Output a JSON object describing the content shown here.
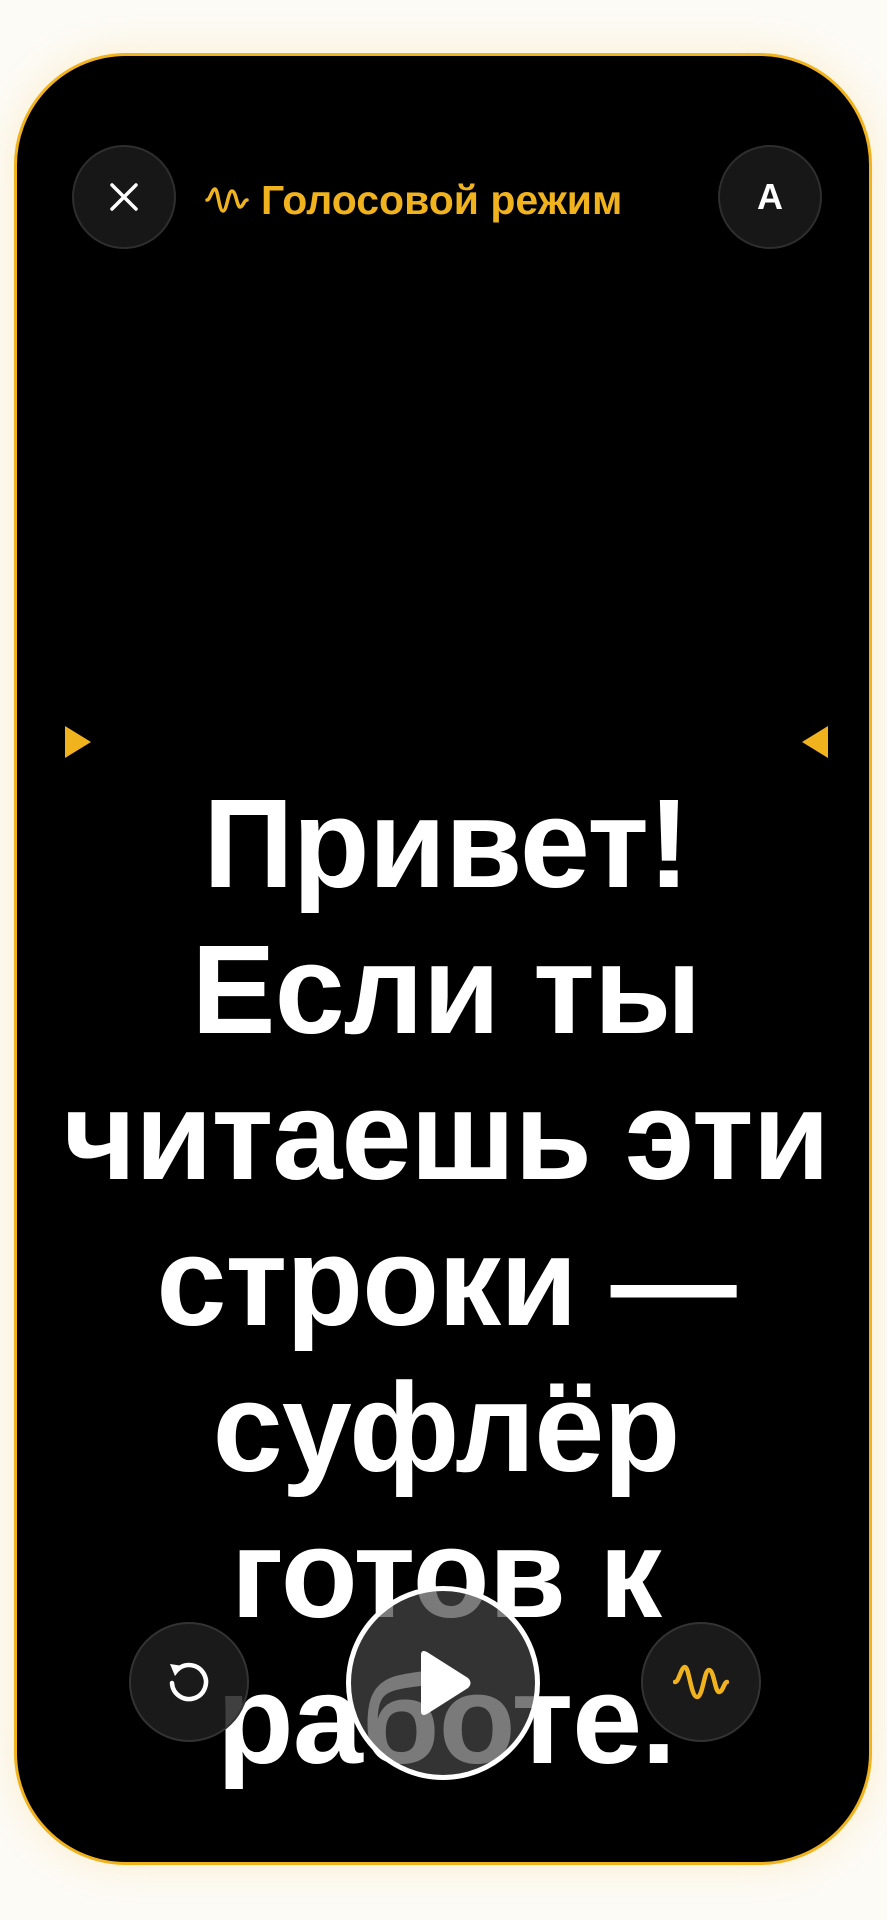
{
  "header": {
    "mode_label": "Голосовой режим",
    "font_button_label": "A"
  },
  "icons": {
    "close": "close-icon",
    "voice_wave": "wave-icon",
    "reset": "reset-icon",
    "play": "play-icon"
  },
  "script": {
    "lines": [
      "Привет!",
      "Если ты",
      "читаешь эти",
      "строки —",
      "суфлёр",
      "готов к",
      "работе."
    ]
  },
  "colors": {
    "accent": "#f0b21d",
    "background": "#000000",
    "text": "#ffffff"
  }
}
